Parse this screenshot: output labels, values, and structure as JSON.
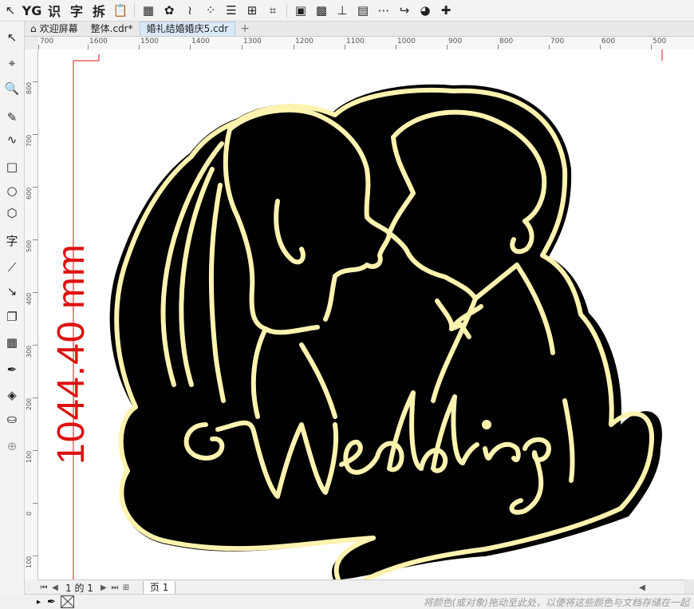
{
  "toolbar": {
    "buttons": [
      {
        "name": "pick-tool-icon",
        "glyph": "↖"
      },
      {
        "name": "yg-plugin-icon",
        "glyph": "YG",
        "text": true
      },
      {
        "name": "recognize-char-button",
        "glyph": "识",
        "text": true
      },
      {
        "name": "char-char-button",
        "glyph": "字",
        "text": true
      },
      {
        "name": "split-char-button",
        "glyph": "拆",
        "text": true
      },
      {
        "name": "paste-special-icon",
        "glyph": "📋"
      },
      {
        "sep": true
      },
      {
        "name": "table-icon",
        "glyph": "▦"
      },
      {
        "name": "flower-shape-icon",
        "glyph": "✿"
      },
      {
        "name": "curve-icon",
        "glyph": "≀"
      },
      {
        "name": "node-align-icon",
        "glyph": "⁘"
      },
      {
        "name": "dashed-lines-icon",
        "glyph": "☰"
      },
      {
        "name": "distribute-icon",
        "glyph": "⊞"
      },
      {
        "name": "select-region-icon",
        "glyph": "⌗"
      },
      {
        "sep": true
      },
      {
        "name": "color-blocks-icon",
        "glyph": "▣"
      },
      {
        "name": "image-icon",
        "glyph": "▩"
      },
      {
        "name": "text-align-icon",
        "glyph": "⊥"
      },
      {
        "name": "grid-yellow-icon",
        "glyph": "▤"
      },
      {
        "name": "dots-grid-icon",
        "glyph": "⋯"
      },
      {
        "name": "magic-arrow-icon",
        "glyph": "↪"
      },
      {
        "name": "leaf-ball-icon",
        "glyph": "◕"
      },
      {
        "name": "puzzle-icon",
        "glyph": "✚"
      }
    ]
  },
  "tabs": [
    {
      "label": "欢迎屏幕",
      "icon": "home-icon",
      "active": false
    },
    {
      "label": "整体.cdr*",
      "icon": "",
      "active": false
    },
    {
      "label": "婚礼结婚婚庆5.cdr",
      "icon": "",
      "active": true
    }
  ],
  "tools": [
    {
      "name": "pick-tool-icon",
      "glyph": "↖"
    },
    {
      "name": "crop-tool-icon",
      "glyph": "⌖"
    },
    {
      "name": "zoom-tool-icon",
      "glyph": "🔍"
    },
    {
      "name": "freehand-tool-icon",
      "glyph": "✎"
    },
    {
      "name": "bezier-tool-icon",
      "glyph": "∿"
    },
    {
      "name": "rectangle-tool-icon",
      "glyph": "□"
    },
    {
      "name": "ellipse-tool-icon",
      "glyph": "○"
    },
    {
      "name": "polygon-tool-icon",
      "glyph": "⬡"
    },
    {
      "name": "text-tool-icon",
      "glyph": "字"
    },
    {
      "name": "dimension-tool-icon",
      "glyph": "⟋"
    },
    {
      "name": "connector-tool-icon",
      "glyph": "↘"
    },
    {
      "name": "shadow-tool-icon",
      "glyph": "❐"
    },
    {
      "name": "transparency-tool-icon",
      "glyph": "▦"
    },
    {
      "name": "eyedropper-tool-icon",
      "glyph": "✒"
    },
    {
      "name": "fill-tool-icon",
      "glyph": "◈"
    },
    {
      "name": "smart-fill-tool-icon",
      "glyph": "⛀"
    },
    {
      "name": "add-tool-icon",
      "glyph": "⊕"
    }
  ],
  "ruler": {
    "h_labels": [
      "700",
      "1600",
      "1500",
      "1400",
      "1300",
      "1200",
      "1100",
      "1000",
      "900",
      "800",
      "700",
      "600",
      "500"
    ],
    "v_labels": [
      "800",
      "700",
      "600",
      "500",
      "400",
      "300",
      "200",
      "100",
      "0",
      "100"
    ]
  },
  "canvas": {
    "dimension_text": "1044.40 mm",
    "wedding_text": "Wedding",
    "colors": {
      "fill": "#000000",
      "stroke": "#fff3b0",
      "dimension": "#dd1111"
    }
  },
  "pagenav": {
    "page_of": "1 的 1",
    "page_tab": "页 1"
  },
  "status": {
    "hint": "将颜色(或对象)拖动至此处，以便将这些颜色与文档存储在一起"
  }
}
